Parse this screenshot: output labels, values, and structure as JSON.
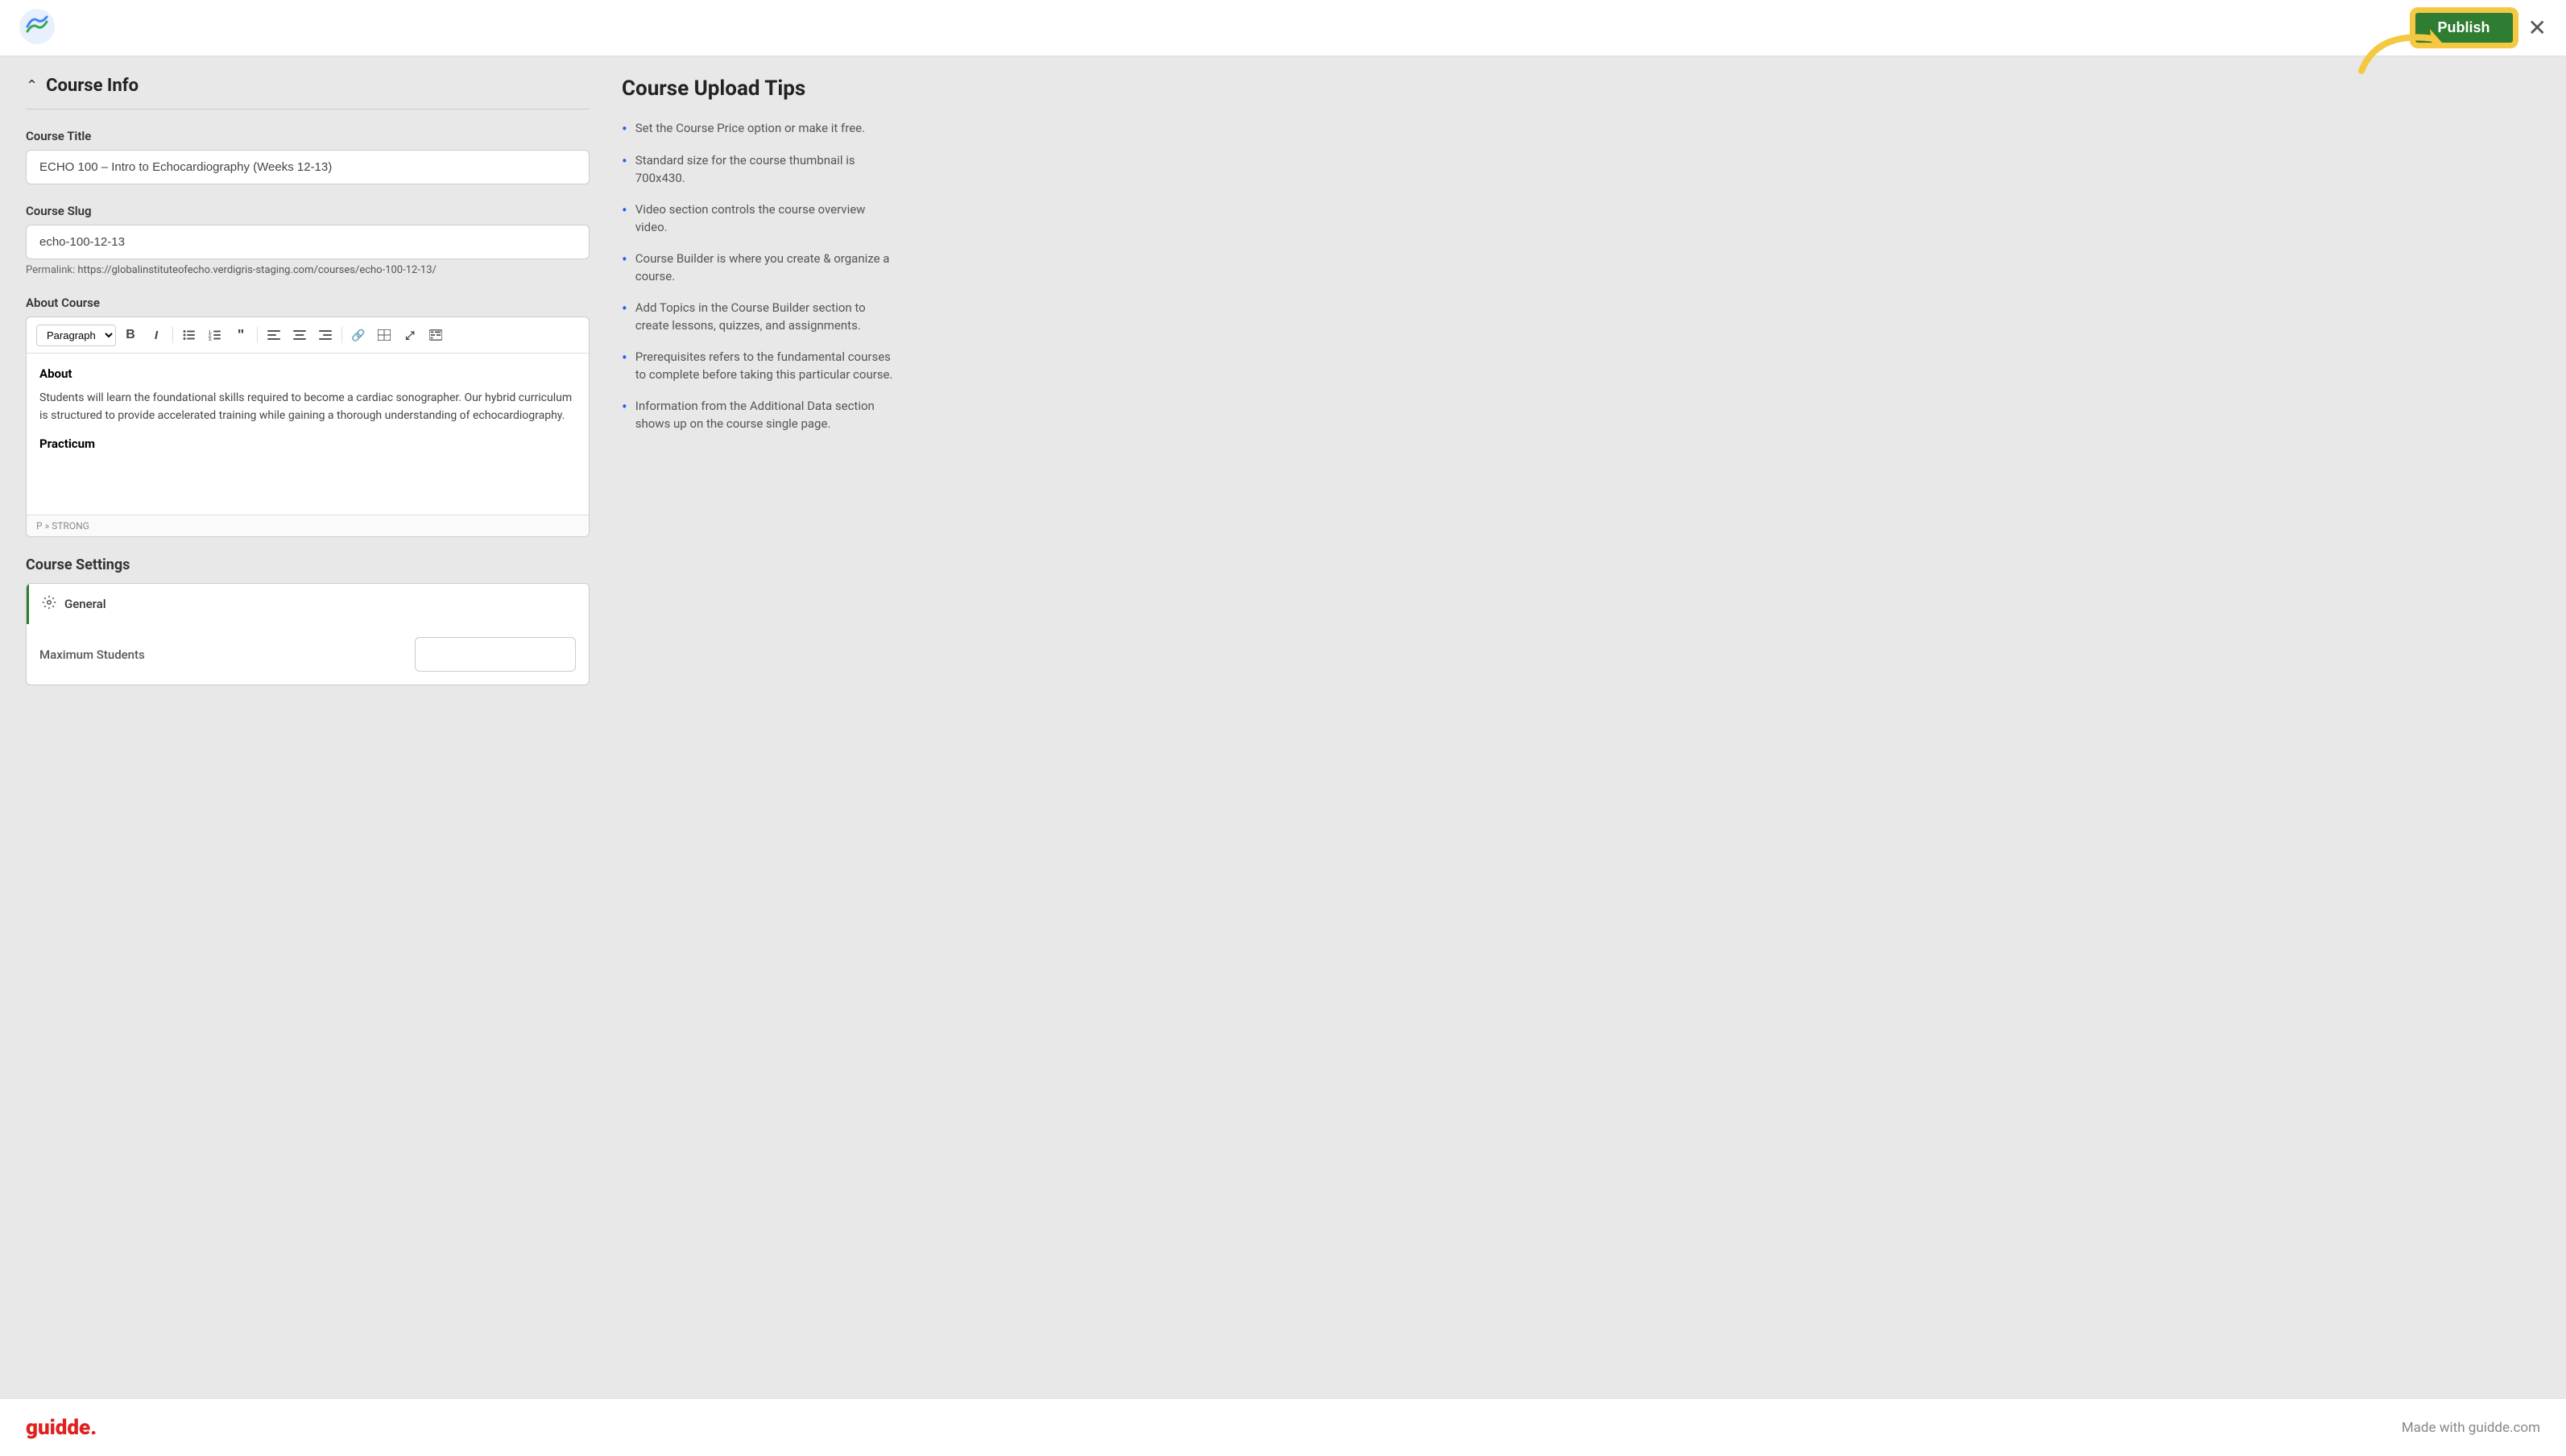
{
  "topbar": {
    "publish_label": "Publish",
    "close_label": "✕"
  },
  "course_info": {
    "section_title": "Course Info",
    "course_title_label": "Course Title",
    "course_title_value": "ECHO 100 – Intro to Echocardiography (Weeks 12-13)",
    "course_slug_label": "Course Slug",
    "course_slug_value": "echo-100-12-13",
    "permalink_prefix": "Permalink:",
    "permalink_url": "https://globalinstituteofecho.verdigris-staging.com/courses/echo-100-12-13/",
    "about_label": "About Course",
    "editor_toolbar": {
      "paragraph": "Paragraph",
      "bold": "B",
      "italic": "I",
      "ul": "≡",
      "ol": "≡",
      "quote": "❝",
      "align_left": "≡",
      "align_center": "≡",
      "align_right": "≡",
      "link": "🔗",
      "table": "⊞",
      "fullscreen": "⤢",
      "code": "⊞"
    },
    "editor_about_heading": "About",
    "editor_paragraph": "Students will learn the foundational skills required to become a cardiac sonographer. Our  hybrid curriculum is structured  to provide accelerated training while gaining a thorough understanding of echocardiography.",
    "editor_practicum": "Practicum",
    "editor_statusbar": "P » STRONG"
  },
  "course_settings": {
    "section_title": "Course Settings",
    "general_tab": "General",
    "max_students_label": "Maximum Students"
  },
  "tips": {
    "title": "Course Upload Tips",
    "items": [
      "Set the Course Price option or make it free.",
      "Standard size for the course thumbnail is 700x430.",
      "Video section controls the course overview video.",
      "Course Builder is where you create & organize a course.",
      "Add Topics in the Course Builder section to create lessons, quizzes, and assignments.",
      "Prerequisites refers to the fundamental courses to complete before taking this particular course.",
      "Information from the Additional Data section shows up on the course single page."
    ]
  },
  "footer": {
    "logo": "guidde.",
    "made_with": "Made with guidde.com"
  }
}
